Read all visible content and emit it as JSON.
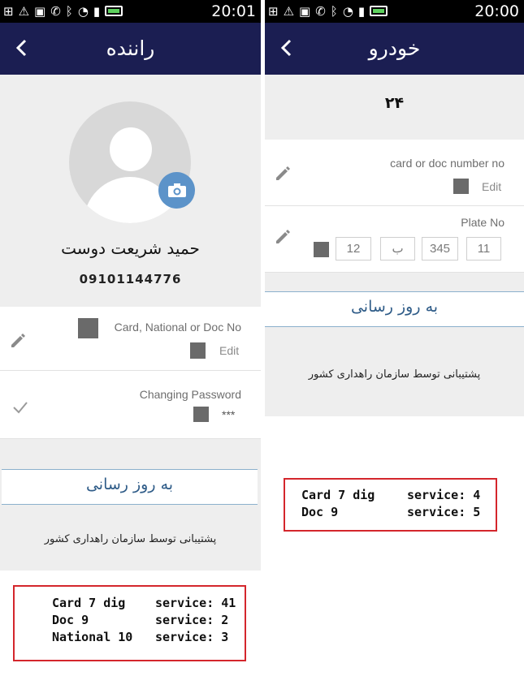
{
  "left_screen": {
    "status_time": "20:01",
    "title": "راننده",
    "driver_name": "حمید شریعت دوست",
    "driver_phone": "09101144776",
    "card_row": {
      "label": "Card, National or Doc No",
      "action": "Edit"
    },
    "password_row": {
      "label": "Changing Password",
      "value": "***"
    },
    "update_button": "به روز رسانی",
    "support_text": "پشتیبانی توسط سازمان راهداری کشور",
    "note": [
      {
        "left": "Card 7 dig",
        "right": "service: 41"
      },
      {
        "left": "Doc 9",
        "right": "service: 2"
      },
      {
        "left": "National 10",
        "right": "service: 3"
      }
    ]
  },
  "right_screen": {
    "status_time": "20:00",
    "title": "خودرو",
    "vehicle_number": "۲۴",
    "card_row": {
      "label": "card or doc number no",
      "action": "Edit"
    },
    "plate_row": {
      "label": "Plate No",
      "fields": [
        "11",
        "345",
        "ب",
        "12"
      ]
    },
    "update_button": "به روز رسانی",
    "support_text": "پشتیبانی توسط سازمان راهداری کشور",
    "note": [
      {
        "left": "Card 7 dig",
        "right": "service: 4"
      },
      {
        "left": "Doc 9",
        "right": "service: 5"
      }
    ]
  },
  "status_icons": [
    "plus-icon",
    "warning-icon",
    "image-icon",
    "phone-icon",
    "bluetooth-icon",
    "nfc-icon",
    "wifi-icon",
    "sim-icon",
    "signal-icon",
    "battery-icon"
  ],
  "colors": {
    "toolbar": "#1b1e52",
    "accent": "#5c93c9",
    "update_text": "#2f5c88",
    "annotation": "#d4262c"
  }
}
